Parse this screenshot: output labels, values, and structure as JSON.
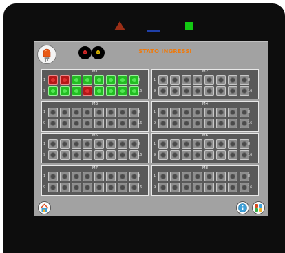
{
  "indicators": {
    "triangle_color": "#9a2e16",
    "line_color": "#1f3fa8",
    "square_color": "#12c912"
  },
  "header": {
    "led_icon": "led-bulb-icon",
    "fault_count": "0",
    "warning_count": "0",
    "status_text": "STATO INGRESSI",
    "status_color": "#ef7a0c"
  },
  "legend": {
    "row1_start": "1",
    "row1_end": "8",
    "row2_start": "9",
    "row2_end": "16"
  },
  "colors": {
    "on": "#23bd23",
    "fault": "#b51818",
    "off": "#8e8e8e"
  },
  "modules": [
    {
      "title": "M1",
      "inputs": [
        "fault",
        "fault",
        "on",
        "on",
        "on",
        "on",
        "on",
        "on",
        "on",
        "on",
        "on",
        "fault",
        "on",
        "on",
        "on",
        "on"
      ]
    },
    {
      "title": "M2",
      "inputs": [
        "off",
        "off",
        "off",
        "off",
        "off",
        "off",
        "off",
        "off",
        "off",
        "off",
        "off",
        "off",
        "off",
        "off",
        "off",
        "off"
      ]
    },
    {
      "title": "M3",
      "inputs": [
        "off",
        "off",
        "off",
        "off",
        "off",
        "off",
        "off",
        "off",
        "off",
        "off",
        "off",
        "off",
        "off",
        "off",
        "off",
        "off"
      ]
    },
    {
      "title": "M4",
      "inputs": [
        "off",
        "off",
        "off",
        "off",
        "off",
        "off",
        "off",
        "off",
        "off",
        "off",
        "off",
        "off",
        "off",
        "off",
        "off",
        "off"
      ]
    },
    {
      "title": "M5",
      "inputs": [
        "off",
        "off",
        "off",
        "off",
        "off",
        "off",
        "off",
        "off",
        "off",
        "off",
        "off",
        "off",
        "off",
        "off",
        "off",
        "off"
      ]
    },
    {
      "title": "M6",
      "inputs": [
        "off",
        "off",
        "off",
        "off",
        "off",
        "off",
        "off",
        "off",
        "off",
        "off",
        "off",
        "off",
        "off",
        "off",
        "off",
        "off"
      ]
    },
    {
      "title": "M7",
      "inputs": [
        "off",
        "off",
        "off",
        "off",
        "off",
        "off",
        "off",
        "off",
        "off",
        "off",
        "off",
        "off",
        "off",
        "off",
        "off",
        "off"
      ]
    },
    {
      "title": "M8",
      "inputs": [
        "off",
        "off",
        "off",
        "off",
        "off",
        "off",
        "off",
        "off",
        "off",
        "off",
        "off",
        "off",
        "off",
        "off",
        "off",
        "off"
      ]
    }
  ],
  "footer": {
    "home_icon": "home-icon",
    "info_icon": "info-icon",
    "apps_icon": "apps-icon"
  }
}
